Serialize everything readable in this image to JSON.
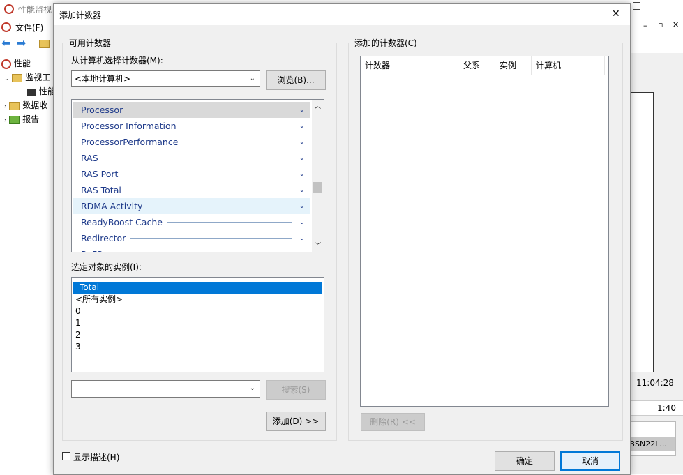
{
  "background": {
    "window_title": "性能监视",
    "menu_file": "文件(F)",
    "tree": [
      "性能",
      "监视工",
      "性能",
      "数据收",
      "报告"
    ],
    "time_label": "11:04:28",
    "duration_label": "1:40",
    "host_fragment": "3SN22L..."
  },
  "dialog": {
    "title": "添加计数器",
    "close_glyph": "✕",
    "available_group": "可用计数器",
    "select_from_label": "从计算机选择计数器(M):",
    "computer_value": "<本地计算机>",
    "browse_button": "浏览(B)...",
    "categories": [
      {
        "label": "Processor",
        "selected": true
      },
      {
        "label": "Processor Information",
        "selected": false
      },
      {
        "label": "ProcessorPerformance",
        "selected": false
      },
      {
        "label": "RAS",
        "selected": false
      },
      {
        "label": "RAS Port",
        "selected": false
      },
      {
        "label": "RAS Total",
        "selected": false
      },
      {
        "label": "RDMA Activity",
        "selected": false,
        "hover": true
      },
      {
        "label": "ReadyBoost Cache",
        "selected": false
      },
      {
        "label": "Redirector",
        "selected": false
      },
      {
        "label": "ReFS",
        "selected": false
      }
    ],
    "instances_label": "选定对象的实例(I):",
    "instances": [
      "_Total",
      "<所有实例>",
      "0",
      "1",
      "2",
      "3"
    ],
    "selected_instance": "_Total",
    "search_value": "",
    "search_button": "搜索(S)",
    "add_button": "添加(D) >>",
    "added_group": "添加的计数器(C)",
    "added_columns": [
      "计数器",
      "父系",
      "实例",
      "计算机"
    ],
    "remove_button": "删除(R) <<",
    "show_description": "显示描述(H)",
    "ok_button": "确定",
    "cancel_button": "取消"
  },
  "colors": {
    "selection": "#0078d7",
    "category_text": "#1e3a8a",
    "dialog_bg": "#f0f0f0"
  }
}
